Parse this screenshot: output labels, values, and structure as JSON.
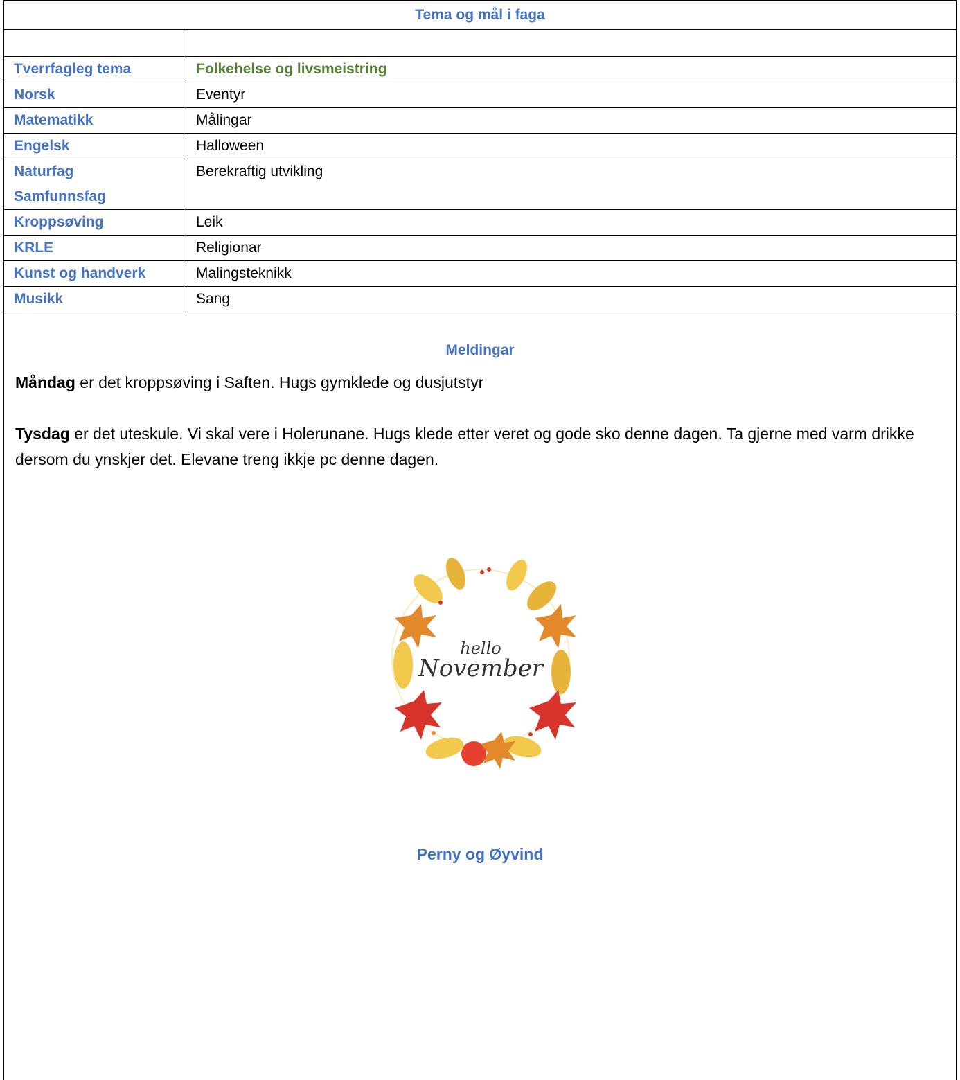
{
  "header": {
    "title": "Tema og mål i faga"
  },
  "table": {
    "rows": [
      {
        "subject": "",
        "content": ""
      },
      {
        "subject": "Tverrfagleg tema",
        "content": "Folkehelse og livsmeistring"
      },
      {
        "subject": "Norsk",
        "content": "Eventyr"
      },
      {
        "subject": "Matematikk",
        "content": "Målingar"
      },
      {
        "subject": "Engelsk",
        "content": "Halloween"
      },
      {
        "subject": "Naturfag",
        "content": "Berekraftig utvikling"
      },
      {
        "subject": "Samfunnsfag",
        "content": ""
      },
      {
        "subject": "Kroppsøving",
        "content": "Leik"
      },
      {
        "subject": "KRLE",
        "content": "Religionar"
      },
      {
        "subject": "Kunst og handverk",
        "content": "Malingsteknikk"
      },
      {
        "subject": "Musikk",
        "content": "Sang"
      }
    ]
  },
  "messages": {
    "heading": "Meldingar",
    "monday": {
      "day": "Måndag",
      "text": " er det kroppsøving i Saften. Hugs gymklede og dusjutstyr"
    },
    "tuesday": {
      "day": "Tysdag",
      "text": " er det uteskule. Vi skal vere i Holerunane. Hugs klede etter veret og gode sko denne dagen. Ta gjerne med varm drikke dersom du ynskjer det. Elevane treng ikkje pc denne dagen."
    }
  },
  "image": {
    "line1": "hello",
    "line2": "November"
  },
  "signature": "Perny og Øyvind",
  "colors": {
    "blue": "#4472C4",
    "green": "#548235",
    "leaf_orange": "#E2892B",
    "leaf_red": "#D9342B",
    "leaf_yellow": "#F2C94C"
  }
}
